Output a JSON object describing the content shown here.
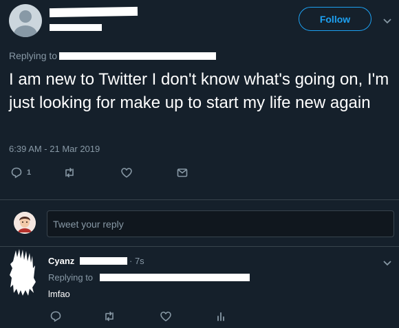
{
  "tweet": {
    "follow_label": "Follow",
    "replying_prefix": "Replying to",
    "text": "I am new to Twitter I don't know what's going on, I'm just looking for make up to start my life new again",
    "timestamp": "6:39 AM - 21 Mar 2019",
    "reply_count": "1",
    "icons": [
      "reply-icon",
      "retweet-icon",
      "like-icon",
      "dm-icon",
      "chevron-down-icon"
    ]
  },
  "compose": {
    "placeholder": "Tweet your reply"
  },
  "reply": {
    "name": "Cyanz",
    "time": "· 7s",
    "replying_prefix": "Replying to",
    "text": "lmfao",
    "icons": [
      "reply-icon",
      "retweet-icon",
      "like-icon",
      "analytics-icon"
    ]
  },
  "colors": {
    "background": "#15202b",
    "accent": "#1da1f2",
    "muted": "#8899a6",
    "divider": "#38444d"
  }
}
